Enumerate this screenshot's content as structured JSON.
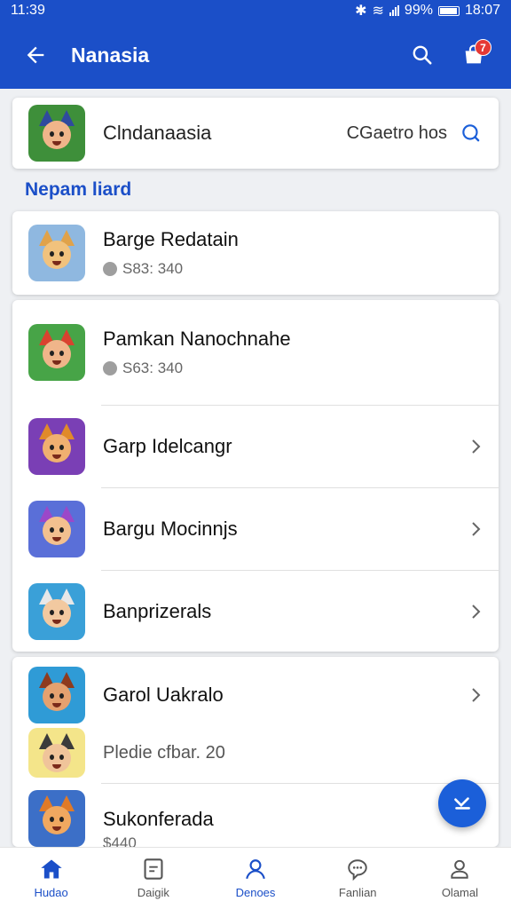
{
  "status": {
    "time": "11:39",
    "battery": "99%",
    "clock": "18:07"
  },
  "app_bar": {
    "title": "Nanasia",
    "notification_count": "7"
  },
  "search_card": {
    "name": "Clndanaasia",
    "hint": "CGaetro hos"
  },
  "section_label": "Nepam liard",
  "items": [
    {
      "name": "Barge Redatain",
      "sub": "S83: 340",
      "avatar_bg": "#8fb8e0",
      "face": "#f1c27d",
      "ear": "#e0a24a"
    },
    {
      "name": "Pamkan Nanochnahe",
      "sub": "S63: 340",
      "avatar_bg": "#47a447",
      "face": "#f0b58a",
      "ear": "#d9422f"
    },
    {
      "name": "Garp Idelcangr",
      "sub": "",
      "avatar_bg": "#7a3fb5",
      "face": "#f0b070",
      "ear": "#e08a2a"
    },
    {
      "name": "Bargu Mocinnjs",
      "sub": "",
      "avatar_bg": "#5a6fd8",
      "face": "#f3c08f",
      "ear": "#9b48c9"
    },
    {
      "name": "Banprizerals",
      "sub": "",
      "avatar_bg": "#3aa0d8",
      "face": "#f2c9a0",
      "ear": "#e8e8e8"
    },
    {
      "name": "Garol Uakralo",
      "sub": "",
      "avatar_bg": "#2f9bd6",
      "face": "#e5a16f",
      "ear": "#8e3b1e"
    },
    {
      "name": "",
      "sub": "Pledie cfbar. 20",
      "avatar_bg": "#f4e58a",
      "face": "#f0c49a",
      "ear": "#3b3b3b"
    },
    {
      "name": "Sukonferada",
      "sub": "$440",
      "avatar_bg": "#3c6fc7",
      "face": "#f0a860",
      "ear": "#e07a28"
    }
  ],
  "nav": [
    {
      "label": "Hudao",
      "icon": "home-icon"
    },
    {
      "label": "Daigik",
      "icon": "document-icon"
    },
    {
      "label": "Denoes",
      "icon": "person-icon"
    },
    {
      "label": "Fanlian",
      "icon": "chat-icon"
    },
    {
      "label": "Olamal",
      "icon": "profile-icon"
    }
  ],
  "colors": {
    "primary": "#1b4fc8",
    "badge": "#e53935"
  }
}
